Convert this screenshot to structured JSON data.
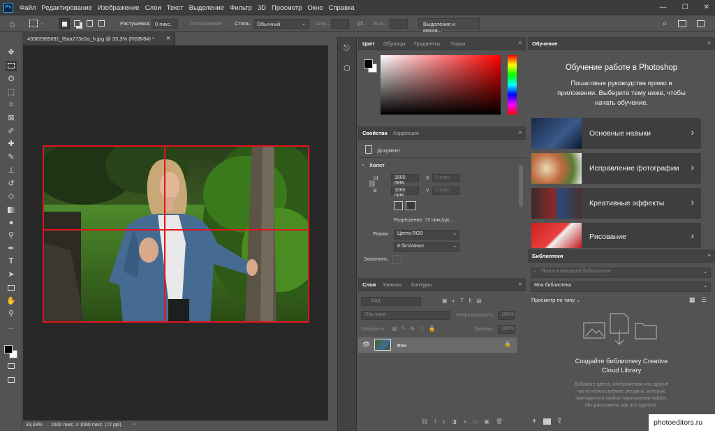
{
  "menubar": {
    "logo": "Ps",
    "items": [
      "Файл",
      "Редактирование",
      "Изображение",
      "Слои",
      "Текст",
      "Выделение",
      "Фильтр",
      "3D",
      "Просмотр",
      "Окно",
      "Справка"
    ]
  },
  "options": {
    "feather_label": "Растушевка:",
    "feather_value": "0 пикс.",
    "antialias": "Сглаживание",
    "style_label": "Стиль:",
    "style_value": "Обычный",
    "width_label": "Шир.:",
    "height_label": "Выс.:",
    "select_mask": "Выделение и маска..."
  },
  "document": {
    "tab_title": "43982985691_f9aa273e2a_h.jpg @ 33,3% (RGB/8#) *",
    "zoom": "33,33%",
    "status_info": "1600 пикс. x 1060 пикс. (72 ppi)"
  },
  "color_panel": {
    "tabs": [
      "Цвет",
      "Образцы",
      "Градиенты",
      "Узоры"
    ]
  },
  "properties_panel": {
    "tabs": [
      "Свойства",
      "Коррекция"
    ],
    "doc_label": "Документ",
    "section": "Холст",
    "w_label": "Ш",
    "w_value": "1600 пикс",
    "h_label": "В",
    "h_value": "1060 пикс",
    "x_label": "X",
    "x_placeholder": "0 пикс",
    "y_label": "Y",
    "y_placeholder": "0 пикс",
    "resolution": "Разрешение: 72 пикс/дю...",
    "mode_label": "Режим",
    "mode_value": "Цвета RGB",
    "depth_value": "8 бит/канал",
    "fill_label": "Заполнить"
  },
  "layers_panel": {
    "tabs": [
      "Слои",
      "Каналы",
      "Контуры"
    ],
    "search_placeholder": "Вид",
    "blend": "Обычные",
    "opacity_label": "Непрозрачность:",
    "opacity_value": "100%",
    "lock_label": "Закрепить:",
    "fill_label": "Заливка:",
    "fill_value": "100%",
    "layer_name": "Фон"
  },
  "learn_panel": {
    "tab": "Обучение",
    "title": "Обучение работе в Photoshop",
    "subtitle_lines": [
      "Пошаговые руководства прямо в",
      "приложении. Выберите тему ниже, чтобы",
      "начать обучение."
    ],
    "cards": [
      "Основные навыки",
      "Исправление фотографии",
      "Креативные эффекты",
      "Рисование"
    ]
  },
  "libraries_panel": {
    "tab": "Библиотеки",
    "search_placeholder": "Поиск в текущей библиотеке",
    "library": "Моя библиотека",
    "view_by": "Просмотр по типу",
    "create_lines": [
      "Создайте библиотеку Creative",
      "Cloud Library"
    ],
    "desc_lines": [
      "Добавьте цвета, изображения или другие",
      "часто используемые ресурсы, которые",
      "пригодятся в любом приложении Adobe.",
      "Мы расскажем, как это сделать."
    ]
  },
  "watermark": "photoeditors.ru",
  "colors": {
    "guide": "#e0141e",
    "accent": "#31a8ff"
  }
}
